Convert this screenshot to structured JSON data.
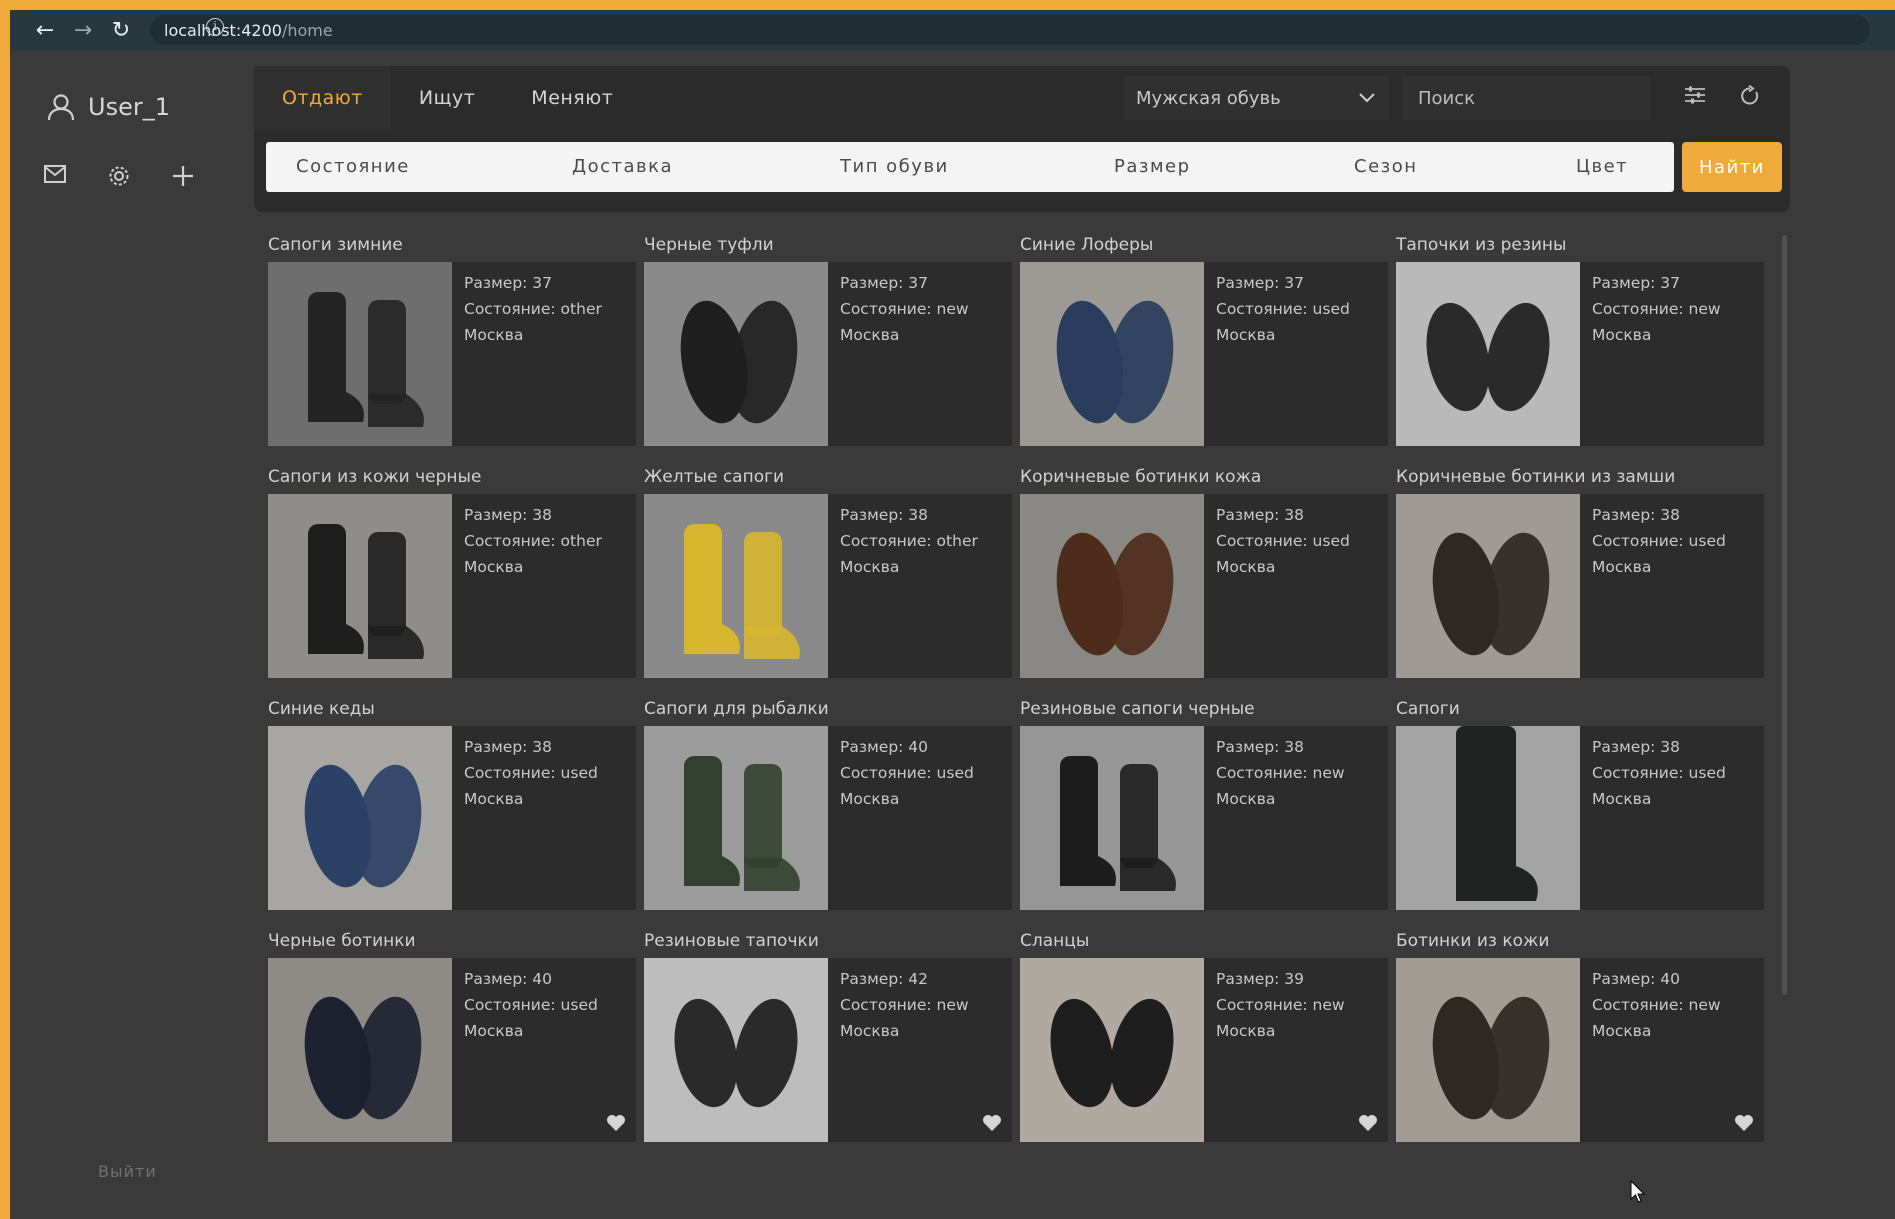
{
  "browser": {
    "url_host": "localhost:4200",
    "url_path": "/home"
  },
  "user": {
    "name": "User_1"
  },
  "sidebar": {
    "logout": "Выйти"
  },
  "tabs": [
    {
      "label": "Отдают",
      "active": true
    },
    {
      "label": "Ищут",
      "active": false
    },
    {
      "label": "Меняют",
      "active": false
    }
  ],
  "category": {
    "selected": "Мужская обувь"
  },
  "search": {
    "placeholder": "Поиск"
  },
  "filters": [
    "Состояние",
    "Доставка",
    "Тип обуви",
    "Размер",
    "Сезон",
    "Цвет"
  ],
  "find_button": "Найти",
  "colors": {
    "accent": "#f0a93b",
    "background": "#3a3a3a",
    "panel": "#2b2b2b"
  },
  "listings": [
    {
      "title": "Сапоги зимние",
      "size": "Размер: 37",
      "condition": "Состояние: other",
      "city": "Москва"
    },
    {
      "title": "Черные туфли",
      "size": "Размер: 37",
      "condition": "Состояние: new",
      "city": "Москва"
    },
    {
      "title": "Синие Лоферы",
      "size": "Размер: 37",
      "condition": "Состояние: used",
      "city": "Москва"
    },
    {
      "title": "Тапочки из резины",
      "size": "Размер: 37",
      "condition": "Состояние: new",
      "city": "Москва"
    },
    {
      "title": "Сапоги из кожи черные",
      "size": "Размер: 38",
      "condition": "Состояние: other",
      "city": "Москва"
    },
    {
      "title": "Желтые сапоги",
      "size": "Размер: 38",
      "condition": "Состояние: other",
      "city": "Москва"
    },
    {
      "title": "Коричневые ботинки кожа",
      "size": "Размер: 38",
      "condition": "Состояние: used",
      "city": "Москва"
    },
    {
      "title": "Коричневые ботинки из замши",
      "size": "Размер: 38",
      "condition": "Состояние: used",
      "city": "Москва"
    },
    {
      "title": "Синие кеды",
      "size": "Размер: 38",
      "condition": "Состояние: used",
      "city": "Москва"
    },
    {
      "title": "Сапоги для рыбалки",
      "size": "Размер: 40",
      "condition": "Состояние: used",
      "city": "Москва"
    },
    {
      "title": "Резиновые сапоги черные",
      "size": "Размер: 38",
      "condition": "Состояние: new",
      "city": "Москва"
    },
    {
      "title": "Сапоги",
      "size": "Размер: 38",
      "condition": "Состояние: used",
      "city": "Москва"
    },
    {
      "title": "Черные ботинки",
      "size": "Размер: 40",
      "condition": "Состояние: used",
      "city": "Москва"
    },
    {
      "title": "Резиновые тапочки",
      "size": "Размер: 42",
      "condition": "Состояние: new",
      "city": "Москва"
    },
    {
      "title": "Сланцы",
      "size": "Размер: 39",
      "condition": "Состояние: new",
      "city": "Москва"
    },
    {
      "title": "Ботинки из кожи",
      "size": "Размер: 40",
      "condition": "Состояние: new",
      "city": "Москва"
    }
  ]
}
